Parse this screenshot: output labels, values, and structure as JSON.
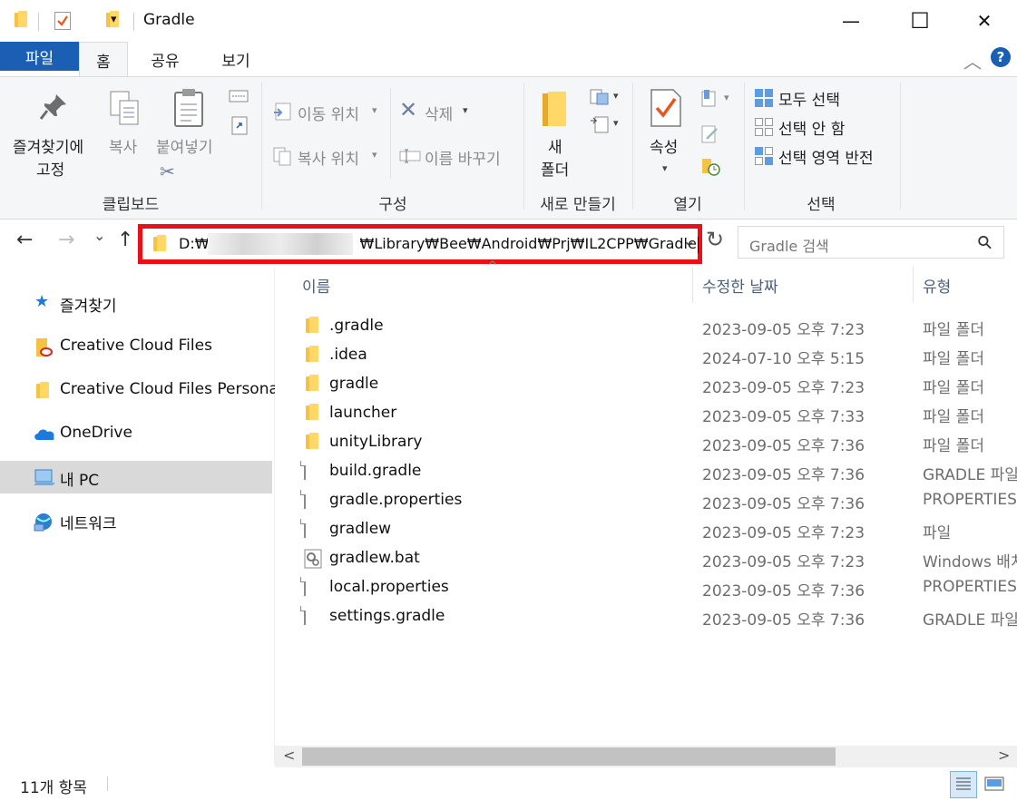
{
  "window": {
    "title": "Gradle",
    "minimize_icon": "minimize-icon",
    "maximize_icon": "maximize-icon",
    "close_icon": "close-icon",
    "minimize_glyph": "—",
    "maximize_glyph": "☐",
    "close_glyph": "✕"
  },
  "ribbon_tabs": [
    {
      "label": "파일",
      "active": false
    },
    {
      "label": "홈",
      "active": true
    },
    {
      "label": "공유",
      "active": false
    },
    {
      "label": "보기",
      "active": false
    }
  ],
  "help_glyph": "?",
  "collapse_glyph": "︿",
  "ribbon": {
    "clipboard": {
      "pin_label_1": "즐겨찾기에",
      "pin_label_2": "고정",
      "copy": "복사",
      "paste": "붙여넣기",
      "group_label": "클립보드"
    },
    "organize": {
      "move_to": "이동 위치",
      "copy_to": "복사 위치",
      "delete": "삭제",
      "rename": "이름 바꾸기",
      "group_label": "구성"
    },
    "new": {
      "new_folder_1": "새",
      "new_folder_2": "폴더",
      "group_label": "새로 만들기"
    },
    "open": {
      "properties": "속성",
      "group_label": "열기"
    },
    "select": {
      "select_all": "모두 선택",
      "select_none": "선택 안 함",
      "invert": "선택 영역 반전",
      "group_label": "선택"
    }
  },
  "nav": {
    "back_glyph": "←",
    "forward_glyph": "→",
    "recent_glyph": "⌄",
    "up_glyph": "↑",
    "refresh_glyph": "↻",
    "dropdown_glyph": "⌄",
    "address_prefix": "D:₩",
    "address_suffix": "₩Library₩Bee₩Android₩Prj₩IL2CPP₩Gradle",
    "search_placeholder": "Gradle 검색",
    "search_glyph": "⚲",
    "highlight_color": "#e8111a"
  },
  "sidebar": [
    {
      "label": "즐겨찾기",
      "icon": "star-icon"
    },
    {
      "label": "Creative Cloud Files",
      "icon": "creative-cloud-folder-icon"
    },
    {
      "label": "Creative Cloud Files Personal",
      "icon": "folder-icon"
    },
    {
      "label": "OneDrive",
      "icon": "onedrive-cloud-icon"
    },
    {
      "label": "내 PC",
      "icon": "computer-icon",
      "selected": true
    },
    {
      "label": "네트워크",
      "icon": "network-icon"
    }
  ],
  "columns": {
    "name": "이름",
    "date": "수정한 날짜",
    "type": "유형",
    "sort_glyph": "^"
  },
  "files": [
    {
      "name": ".gradle",
      "date": "2023-09-05 오후 7:23",
      "type": "파일 폴더",
      "kind": "folder"
    },
    {
      "name": ".idea",
      "date": "2024-07-10 오후 5:15",
      "type": "파일 폴더",
      "kind": "folder"
    },
    {
      "name": "gradle",
      "date": "2023-09-05 오후 7:23",
      "type": "파일 폴더",
      "kind": "folder"
    },
    {
      "name": "launcher",
      "date": "2023-09-05 오후 7:33",
      "type": "파일 폴더",
      "kind": "folder"
    },
    {
      "name": "unityLibrary",
      "date": "2023-09-05 오후 7:36",
      "type": "파일 폴더",
      "kind": "folder"
    },
    {
      "name": "build.gradle",
      "date": "2023-09-05 오후 7:36",
      "type": "GRADLE 파일",
      "kind": "file"
    },
    {
      "name": "gradle.properties",
      "date": "2023-09-05 오후 7:36",
      "type": "PROPERTIES",
      "kind": "file"
    },
    {
      "name": "gradlew",
      "date": "2023-09-05 오후 7:23",
      "type": "파일",
      "kind": "file"
    },
    {
      "name": "gradlew.bat",
      "date": "2023-09-05 오후 7:23",
      "type": "Windows 배치",
      "kind": "bat"
    },
    {
      "name": "local.properties",
      "date": "2023-09-05 오후 7:36",
      "type": "PROPERTIES",
      "kind": "file"
    },
    {
      "name": "settings.gradle",
      "date": "2023-09-05 오후 7:36",
      "type": "GRADLE 파일",
      "kind": "file"
    }
  ],
  "scroll": {
    "left_glyph": "<",
    "right_glyph": ">"
  },
  "status": {
    "item_count": "11개 항목"
  }
}
